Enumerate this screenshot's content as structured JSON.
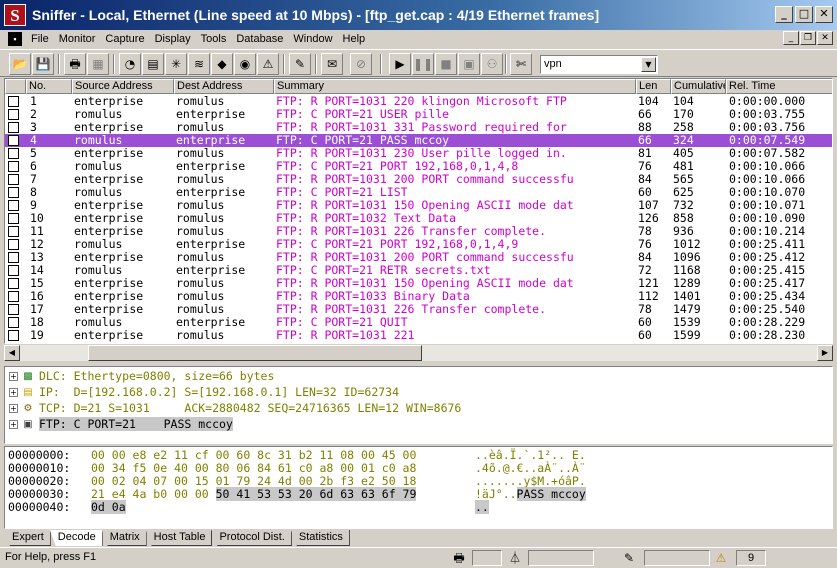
{
  "window": {
    "title": "Sniffer - Local, Ethernet (Line speed at 10 Mbps) - [ftp_get.cap : 4/19 Ethernet frames]",
    "logo_letter": "S"
  },
  "menu": [
    {
      "label": "File",
      "key": "F"
    },
    {
      "label": "Monitor",
      "key": "M"
    },
    {
      "label": "Capture",
      "key": "C"
    },
    {
      "label": "Display",
      "key": "D"
    },
    {
      "label": "Tools",
      "key": "T"
    },
    {
      "label": "Database",
      "key": "a"
    },
    {
      "label": "Window",
      "key": "W"
    },
    {
      "label": "Help",
      "key": "H"
    }
  ],
  "toolbar": {
    "filter_value": "vpn"
  },
  "frame_list": {
    "columns": [
      "No.",
      "Source Address",
      "Dest Address",
      "Summary",
      "Len",
      "Cumulative",
      "Rel. Time"
    ],
    "selected_index": 3,
    "rows": [
      {
        "no": "1",
        "src": "enterprise",
        "dst": "romulus",
        "summary": "FTP: R PORT=1031    220 klingon Microsoft FTP",
        "len": "104",
        "cum": "104",
        "time": "0:00:00.000"
      },
      {
        "no": "2",
        "src": "romulus",
        "dst": "enterprise",
        "summary": "FTP: C PORT=21    USER pille",
        "len": "66",
        "cum": "170",
        "time": "0:00:03.755"
      },
      {
        "no": "3",
        "src": "enterprise",
        "dst": "romulus",
        "summary": "FTP: R PORT=1031    331 Password required for",
        "len": "88",
        "cum": "258",
        "time": "0:00:03.756"
      },
      {
        "no": "4",
        "src": "romulus",
        "dst": "enterprise",
        "summary": "FTP: C PORT=21    PASS mccoy",
        "len": "66",
        "cum": "324",
        "time": "0:00:07.549"
      },
      {
        "no": "5",
        "src": "enterprise",
        "dst": "romulus",
        "summary": "FTP: R PORT=1031    230 User pille logged in.",
        "len": "81",
        "cum": "405",
        "time": "0:00:07.582"
      },
      {
        "no": "6",
        "src": "romulus",
        "dst": "enterprise",
        "summary": "FTP: C PORT=21    PORT 192,168,0,1,4,8",
        "len": "76",
        "cum": "481",
        "time": "0:00:10.066"
      },
      {
        "no": "7",
        "src": "enterprise",
        "dst": "romulus",
        "summary": "FTP: R PORT=1031    200 PORT command successfu",
        "len": "84",
        "cum": "565",
        "time": "0:00:10.066"
      },
      {
        "no": "8",
        "src": "romulus",
        "dst": "enterprise",
        "summary": "FTP: C PORT=21    LIST",
        "len": "60",
        "cum": "625",
        "time": "0:00:10.070"
      },
      {
        "no": "9",
        "src": "enterprise",
        "dst": "romulus",
        "summary": "FTP: R PORT=1031    150 Opening ASCII mode dat",
        "len": "107",
        "cum": "732",
        "time": "0:00:10.071"
      },
      {
        "no": "10",
        "src": "enterprise",
        "dst": "romulus",
        "summary": "FTP: R PORT=1032    Text Data",
        "len": "126",
        "cum": "858",
        "time": "0:00:10.090"
      },
      {
        "no": "11",
        "src": "enterprise",
        "dst": "romulus",
        "summary": "FTP: R PORT=1031    226 Transfer complete.",
        "len": "78",
        "cum": "936",
        "time": "0:00:10.214"
      },
      {
        "no": "12",
        "src": "romulus",
        "dst": "enterprise",
        "summary": "FTP: C PORT=21    PORT 192,168,0,1,4,9",
        "len": "76",
        "cum": "1012",
        "time": "0:00:25.411"
      },
      {
        "no": "13",
        "src": "enterprise",
        "dst": "romulus",
        "summary": "FTP: R PORT=1031    200 PORT command successfu",
        "len": "84",
        "cum": "1096",
        "time": "0:00:25.412"
      },
      {
        "no": "14",
        "src": "romulus",
        "dst": "enterprise",
        "summary": "FTP: C PORT=21    RETR secrets.txt",
        "len": "72",
        "cum": "1168",
        "time": "0:00:25.415"
      },
      {
        "no": "15",
        "src": "enterprise",
        "dst": "romulus",
        "summary": "FTP: R PORT=1031    150 Opening ASCII mode dat",
        "len": "121",
        "cum": "1289",
        "time": "0:00:25.417"
      },
      {
        "no": "16",
        "src": "enterprise",
        "dst": "romulus",
        "summary": "FTP: R PORT=1033    Binary Data",
        "len": "112",
        "cum": "1401",
        "time": "0:00:25.434"
      },
      {
        "no": "17",
        "src": "enterprise",
        "dst": "romulus",
        "summary": "FTP: R PORT=1031    226 Transfer complete.",
        "len": "78",
        "cum": "1479",
        "time": "0:00:25.540"
      },
      {
        "no": "18",
        "src": "romulus",
        "dst": "enterprise",
        "summary": "FTP: C PORT=21    QUIT",
        "len": "60",
        "cum": "1539",
        "time": "0:00:28.229"
      },
      {
        "no": "19",
        "src": "enterprise",
        "dst": "romulus",
        "summary": "FTP: R PORT=1031    221",
        "len": "60",
        "cum": "1599",
        "time": "0:00:28.230"
      }
    ]
  },
  "decode": {
    "lines": [
      {
        "text": "DLC: Ethertype=0800, size=66 bytes",
        "icon": "dlc-icon",
        "highlight": false
      },
      {
        "text": "IP:  D=[192.168.0.2] S=[192.168.0.1] LEN=32 ID=62734",
        "icon": "ip-icon",
        "highlight": false
      },
      {
        "text": "TCP: D=21 S=1031     ACK=2880482 SEQ=24716365 LEN=12 WIN=8676",
        "icon": "tcp-icon",
        "highlight": false
      },
      {
        "text": "FTP: C PORT=21    PASS mccoy",
        "icon": "ftp-icon",
        "highlight": true
      }
    ]
  },
  "hex": {
    "rows": [
      {
        "offset": "00000000:",
        "bytes": "00 00 e8 e2 11 cf 00 60 8c 31 b2 11 08 00 45 00",
        "hl_bytes": "",
        "ascii": "..èâ.Ï.`.1².. E.",
        "hl_ascii": ""
      },
      {
        "offset": "00000010:",
        "bytes": "00 34 f5 0e 40 00 80 06 84 61 c0 a8 00 01 c0 a8",
        "hl_bytes": "",
        "ascii": ".4õ.@.€..aÀ¨..À¨",
        "hl_ascii": ""
      },
      {
        "offset": "00000020:",
        "bytes": "00 02 04 07 00 15 01 79 24 4d 00 2b f3 e2 50 18",
        "hl_bytes": "",
        "ascii": ".......y$M.+óâP.",
        "hl_ascii": ""
      },
      {
        "offset": "00000030:",
        "bytes": "21 e4 4a b0 00 00 ",
        "hl_bytes": "50 41 53 53 20 6d 63 63 6f 79",
        "ascii": "!äJ°..",
        "hl_ascii": "PASS mccoy"
      },
      {
        "offset": "00000040:",
        "bytes": "",
        "hl_bytes": "0d 0a",
        "ascii": "",
        "hl_ascii": ".."
      }
    ]
  },
  "tabs": [
    {
      "label": "Expert",
      "active": false
    },
    {
      "label": "Decode",
      "active": true
    },
    {
      "label": "Matrix",
      "active": false
    },
    {
      "label": "Host Table",
      "active": false
    },
    {
      "label": "Protocol Dist.",
      "active": false
    },
    {
      "label": "Statistics",
      "active": false
    }
  ],
  "status": {
    "help_text": "For Help, press F1",
    "count": "9"
  },
  "colors": {
    "selected_row": "#9a4fd4",
    "summary_text": "#d000d0",
    "decode_text": "#808000"
  }
}
